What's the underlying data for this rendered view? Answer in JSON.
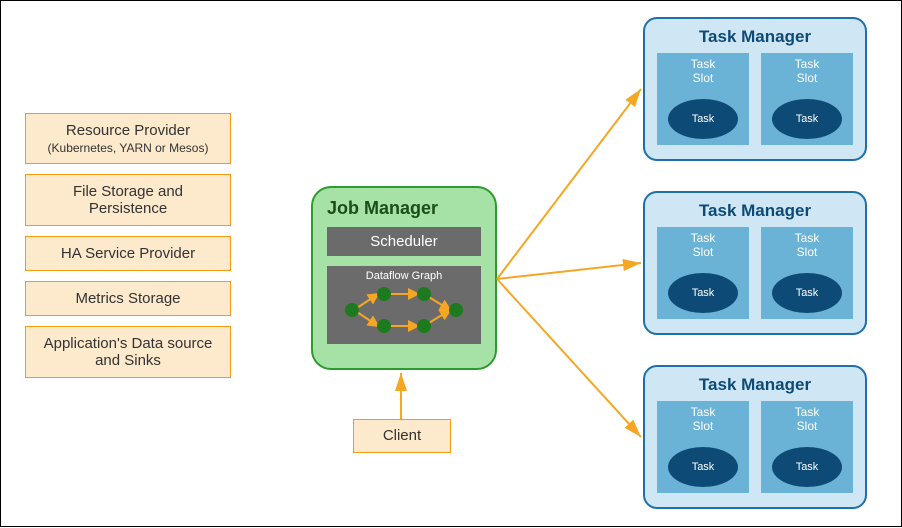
{
  "sidebar": {
    "resource_provider": "Resource Provider",
    "resource_provider_sub": "(Kubernetes, YARN or Mesos)",
    "file_storage": "File Storage and Persistence",
    "ha_service": "HA Service Provider",
    "metrics_storage": "Metrics Storage",
    "app_data": "Application's Data source and Sinks"
  },
  "job_manager": {
    "title": "Job Manager",
    "scheduler": "Scheduler",
    "dataflow_graph": "Dataflow Graph"
  },
  "client": {
    "label": "Client"
  },
  "task_manager": {
    "title": "Task Manager",
    "slot_label_1": "Task",
    "slot_label_2": "Slot",
    "task_label": "Task"
  },
  "colors": {
    "orange_border": "#f39c12",
    "orange_fill": "#fde9cc",
    "green_fill": "#a6e2a6",
    "green_border": "#2e9b2e",
    "blue_border": "#1f6fa8",
    "blue_fill": "#cfe7f5",
    "slot_fill": "#6bb3d6",
    "task_fill": "#0d4a75",
    "arrow": "#f5a623"
  }
}
